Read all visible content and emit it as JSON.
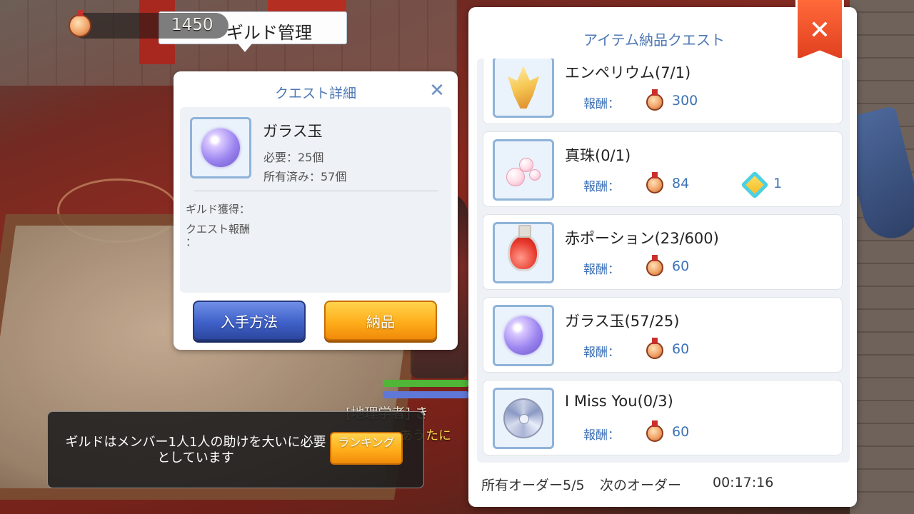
{
  "guild_header": {
    "title": "ギルド管理",
    "points": "1450"
  },
  "quest_detail": {
    "title": "クエスト詳細",
    "item_name": "ガラス玉",
    "required": "必要：25個",
    "owned": "所有済み：57個",
    "guild_gain_label": "ギルド獲得：",
    "quest_reward_label": "クエスト報酬\n：",
    "how_to_get_button": "入手方法",
    "deliver_button": "納品"
  },
  "delivery_quest": {
    "title": "アイテム納品クエスト",
    "close_icon": "close-icon",
    "reward_label": "報酬：",
    "items": [
      {
        "name": "エンペリウム(7/1)",
        "reward": "300",
        "icon": "emperium-crystal-icon"
      },
      {
        "name": "真珠(0/1)",
        "reward": "84",
        "bonus": "1",
        "icon": "pearl-icon"
      },
      {
        "name": "赤ポーション(23/600)",
        "reward": "60",
        "icon": "red-potion-icon"
      },
      {
        "name": "ガラス玉(57/25)",
        "reward": "60",
        "icon": "glass-orb-icon"
      },
      {
        "name": "I Miss You(0/3)",
        "reward": "60",
        "icon": "disc-icon"
      }
    ],
    "orders_owned": "所有オーダー5/5",
    "next_order_label": "次のオーダー",
    "next_order_timer": "00:17:16"
  },
  "tip_box": {
    "message": "ギルドはメンバー1人1人の助けを大いに必要としています",
    "ranking_button": "ランキング"
  },
  "scene": {
    "chat_line": "[地理学者] き",
    "chat_line2": "あうたに"
  },
  "colors": {
    "accent_blue": "#4f78b4",
    "reward_blue": "#3d72b8",
    "button_orange": "#ffae1b",
    "button_blue": "#3f61c9",
    "close_red": "#e1401f"
  }
}
